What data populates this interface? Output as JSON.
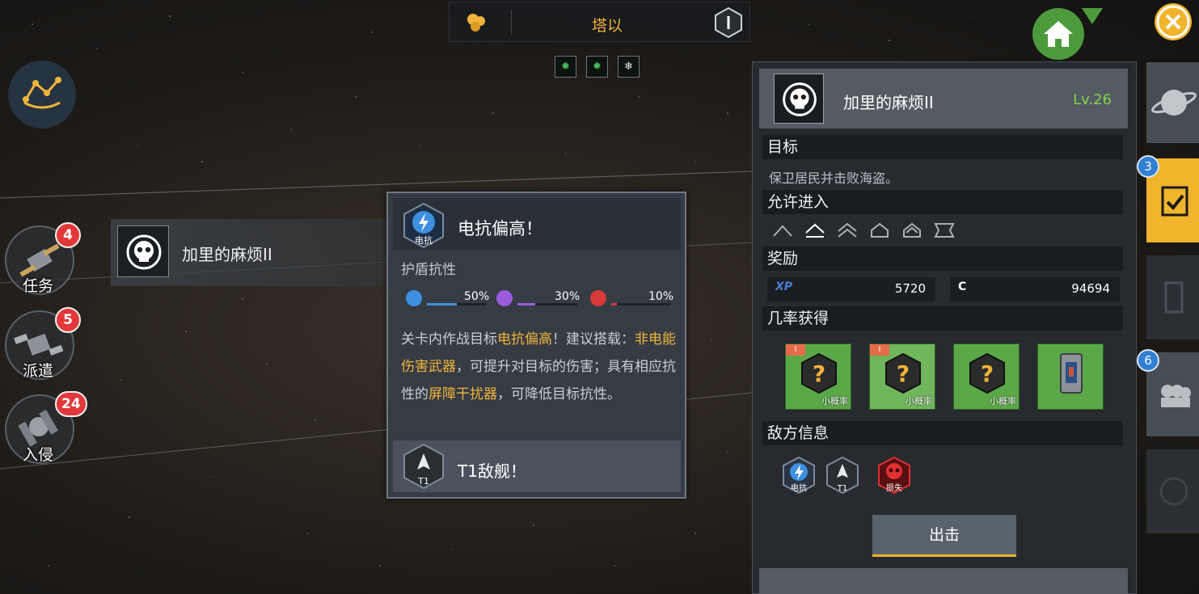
{
  "topbar": {
    "title": "塔以"
  },
  "status_effects": [
    "green-gear",
    "green-gear",
    "snowflake"
  ],
  "side_menu": [
    {
      "label": "任务",
      "badge": "4"
    },
    {
      "label": "派遣",
      "badge": "5"
    },
    {
      "label": "入侵",
      "badge": "24"
    }
  ],
  "map_mission": {
    "name": "加里的麻烦II"
  },
  "tooltip": {
    "title": "电抗偏高！",
    "hex_label": "电抗",
    "subtitle": "护盾抗性",
    "resistances": [
      {
        "type": "electric",
        "percent": "50%",
        "value": 0.5,
        "color": "#3d8fe0"
      },
      {
        "type": "void",
        "percent": "30%",
        "value": 0.3,
        "color": "#9a5bdc"
      },
      {
        "type": "fire",
        "percent": "10%",
        "value": 0.1,
        "color": "#d83a3a"
      }
    ],
    "body": [
      {
        "text": "关卡内作战目标",
        "hl": false
      },
      {
        "text": "电抗偏高",
        "hl": true
      },
      {
        "text": "！建议搭载：",
        "hl": false
      },
      {
        "text": "非电能伤害武器",
        "hl": true
      },
      {
        "text": "，可提升对目标的伤害；具有相应抗性的",
        "hl": false
      },
      {
        "text": "屏障干扰器",
        "hl": true
      },
      {
        "text": "，可降低目标抗性。",
        "hl": false
      }
    ],
    "footer_title": "T1敌舰！",
    "footer_hex_label": "T1"
  },
  "panel": {
    "mission_name": "加里的麻烦II",
    "level": "Lv.26",
    "sections": {
      "objective": "目标",
      "allowed": "允许进入",
      "reward": "奖励",
      "chance": "几率获得",
      "enemy": "敌方信息"
    },
    "objective_text": "保卫居民并击败海盗。",
    "rewards": [
      {
        "label": "XP",
        "value": "5720",
        "color": "#4a7fd4"
      },
      {
        "label": "C",
        "value": "94694",
        "color": "#ffffff"
      }
    ],
    "drops": [
      {
        "tier": "I",
        "chance": "小概率",
        "type": "mystery"
      },
      {
        "tier": "I",
        "chance": "小概率",
        "type": "mystery"
      },
      {
        "tier": "",
        "chance": "小概率",
        "type": "mystery"
      },
      {
        "tier": "",
        "chance": "",
        "type": "module"
      }
    ],
    "enemy_info": [
      {
        "label": "电抗",
        "type": "electric"
      },
      {
        "label": "T1",
        "type": "tier"
      },
      {
        "label": "损失",
        "type": "loss"
      }
    ],
    "go_button": "出击"
  },
  "right_tabs": [
    {
      "name": "planet",
      "badge": ""
    },
    {
      "name": "tasks",
      "badge": "3"
    },
    {
      "name": "station",
      "badge": ""
    },
    {
      "name": "fleet",
      "badge": "6"
    },
    {
      "name": "emblem",
      "badge": ""
    }
  ]
}
